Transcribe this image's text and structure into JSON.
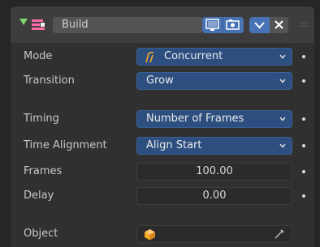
{
  "modifier": {
    "name": "Build",
    "name_placeholder": "Build"
  },
  "icons": {
    "expand": "triangle-down-icon",
    "modifier_type": "build-modifier-icon",
    "realtime": "monitor-icon",
    "render": "camera-icon",
    "apply": "chevron-down-icon",
    "delete": "close-icon",
    "drag": "drag-grip-icon",
    "object_field": "object-cube-icon",
    "eyedropper": "eyedropper-icon"
  },
  "rows": {
    "mode": {
      "label": "Mode",
      "value": "Concurrent"
    },
    "transition": {
      "label": "Transition",
      "value": "Grow"
    },
    "timing": {
      "label": "Timing",
      "value": "Number of Frames"
    },
    "time_alignment": {
      "label": "Time Alignment",
      "value": "Align Start"
    },
    "frames": {
      "label": "Frames",
      "value": "100.00"
    },
    "delay": {
      "label": "Delay",
      "value": "0.00"
    },
    "object": {
      "label": "Object",
      "value": ""
    }
  },
  "colors": {
    "accent": "#4772b3",
    "dropdown_bg": "#2c4f80",
    "expand_arrow": "#7fd470",
    "modifier_icon": "#ff6aa8",
    "object_cube": "#f5a623"
  }
}
